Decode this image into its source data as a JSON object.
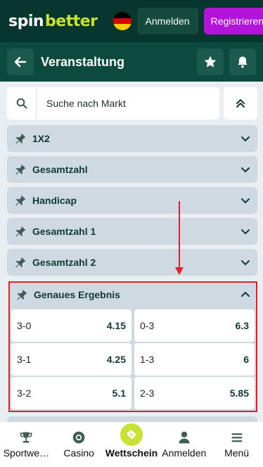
{
  "topbar": {
    "logo_spin": "spin",
    "logo_better": "better",
    "login_label": "Anmelden",
    "register_label": "Registrieren",
    "flag_icon": "germany-flag-icon"
  },
  "header": {
    "title": "Veranstaltung",
    "back_icon": "arrow-left-icon",
    "favorite_icon": "star-icon",
    "notify_icon": "bell-icon"
  },
  "search": {
    "placeholder": "Suche nach Markt",
    "icon": "search-icon",
    "collapse_icon": "chevrons-up-icon"
  },
  "markets": [
    {
      "label": "1X2"
    },
    {
      "label": "Gesamtzahl"
    },
    {
      "label": "Handicap"
    },
    {
      "label": "Gesamtzahl 1"
    },
    {
      "label": "Gesamtzahl 2"
    }
  ],
  "expanded_market": {
    "label": "Genaues Ergebnis",
    "rows": [
      [
        {
          "sel": "3-0",
          "odd": "4.15"
        },
        {
          "sel": "0-3",
          "odd": "6.3"
        }
      ],
      [
        {
          "sel": "3-1",
          "odd": "4.25"
        },
        {
          "sel": "1-3",
          "odd": "6"
        }
      ],
      [
        {
          "sel": "3-2",
          "odd": "5.1"
        },
        {
          "sel": "2-3",
          "odd": "5.85"
        }
      ]
    ]
  },
  "bottom_nav": [
    {
      "label": "Sportwe…",
      "icon": "trophy-icon"
    },
    {
      "label": "Casino",
      "icon": "casino-chip-icon"
    },
    {
      "label": "Wettschein",
      "icon": "ticket-icon",
      "active": true
    },
    {
      "label": "Anmelden",
      "icon": "user-icon"
    },
    {
      "label": "Menü",
      "icon": "menu-icon"
    }
  ],
  "colors": {
    "brand_dark": "#07362e",
    "brand_accent": "#c7e234",
    "register": "#b413d9",
    "highlight": "#e0202a"
  }
}
